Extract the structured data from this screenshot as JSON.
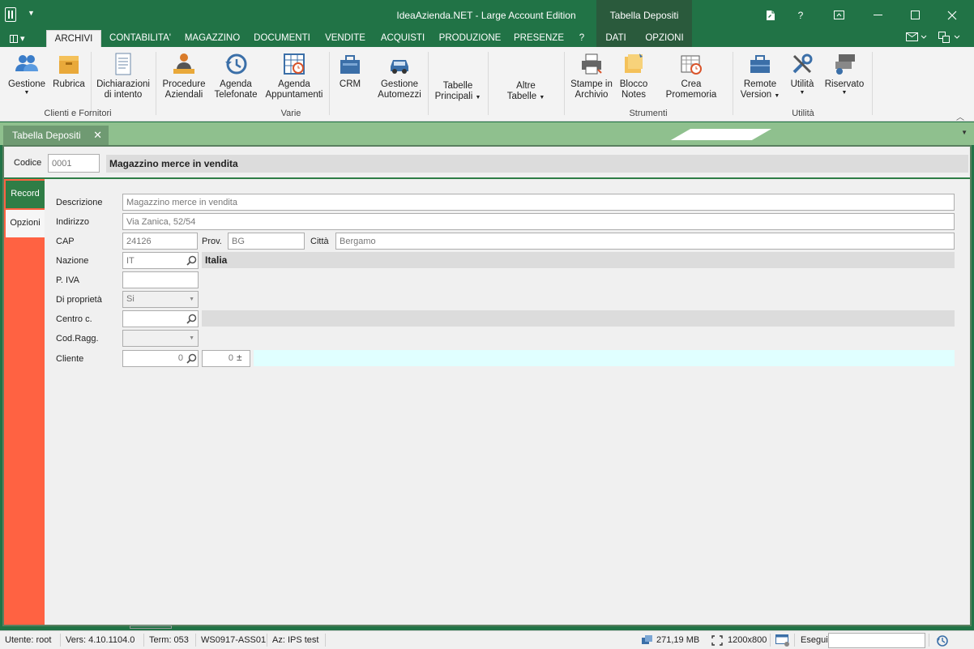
{
  "window": {
    "title": "IdeaAzienda.NET - Large Account Edition",
    "context_tab_title": "Tabella Depositi",
    "help": "?"
  },
  "ribbon_tabs": [
    "ARCHIVI",
    "CONTABILITA'",
    "MAGAZZINO",
    "DOCUMENTI",
    "VENDITE",
    "ACQUISTI",
    "PRODUZIONE",
    "PRESENZE",
    "?",
    "DATI",
    "OPZIONI"
  ],
  "active_tab": "ARCHIVI",
  "ribbon": {
    "gestione": "Gestione",
    "rubrica": "Rubrica",
    "dichiarazioni_1": "Dichiarazioni",
    "dichiarazioni_2": "di intento",
    "procedure_1": "Procedure",
    "procedure_2": "Aziendali",
    "agenda_tel_1": "Agenda",
    "agenda_tel_2": "Telefonate",
    "agenda_app_1": "Agenda",
    "agenda_app_2": "Appuntamenti",
    "crm": "CRM",
    "automezzi_1": "Gestione",
    "automezzi_2": "Automezzi",
    "tabelle_1": "Tabelle",
    "tabelle_2": "Principali",
    "altre_1": "Altre",
    "altre_2": "Tabelle",
    "stampe_1": "Stampe in",
    "stampe_2": "Archivio",
    "blocco_1": "Blocco",
    "blocco_2": "Notes",
    "promemoria": "Crea Promemoria",
    "remote_1": "Remote",
    "remote_2": "Version",
    "utilita": "Utilità",
    "riservato": "Riservato",
    "group_clienti": "Clienti e Fornitori",
    "group_varie": "Varie",
    "group_strumenti": "Strumenti",
    "group_utilita": "Utilità"
  },
  "doc_tab": {
    "label": "Tabella Depositi",
    "close": "✕"
  },
  "header": {
    "codice_label": "Codice",
    "codice_value": "0001",
    "description": "Magazzino merce in vendita"
  },
  "side_tabs": {
    "record": "Record",
    "opzioni": "Opzioni"
  },
  "form": {
    "descrizione_label": "Descrizione",
    "descrizione_value": "Magazzino merce in vendita",
    "indirizzo_label": "Indirizzo",
    "indirizzo_value": "Via Zanica, 52/54",
    "cap_label": "CAP",
    "cap_value": "24126",
    "prov_label": "Prov.",
    "prov_value": "BG",
    "citta_label": "Città",
    "citta_value": "Bergamo",
    "nazione_label": "Nazione",
    "nazione_value": "IT",
    "nazione_desc": "Italia",
    "piva_label": "P. IVA",
    "piva_value": "",
    "proprieta_label": "Di proprietà",
    "proprieta_value": "Si",
    "centro_label": "Centro c.",
    "centro_value": "",
    "codragg_label": "Cod.Ragg.",
    "codragg_value": "",
    "cliente_label": "Cliente",
    "cliente_value": "0",
    "cliente_value2": "0",
    "plusminus": "±"
  },
  "status": {
    "utente": "Utente: root",
    "vers": "Vers: 4.10.1104.0",
    "term": "Term: 053",
    "ws": "WS0917-ASS01",
    "az": "Az: IPS test",
    "memory": "271,19 MB",
    "resolution": "1200x800",
    "esegui": "Esegui"
  }
}
